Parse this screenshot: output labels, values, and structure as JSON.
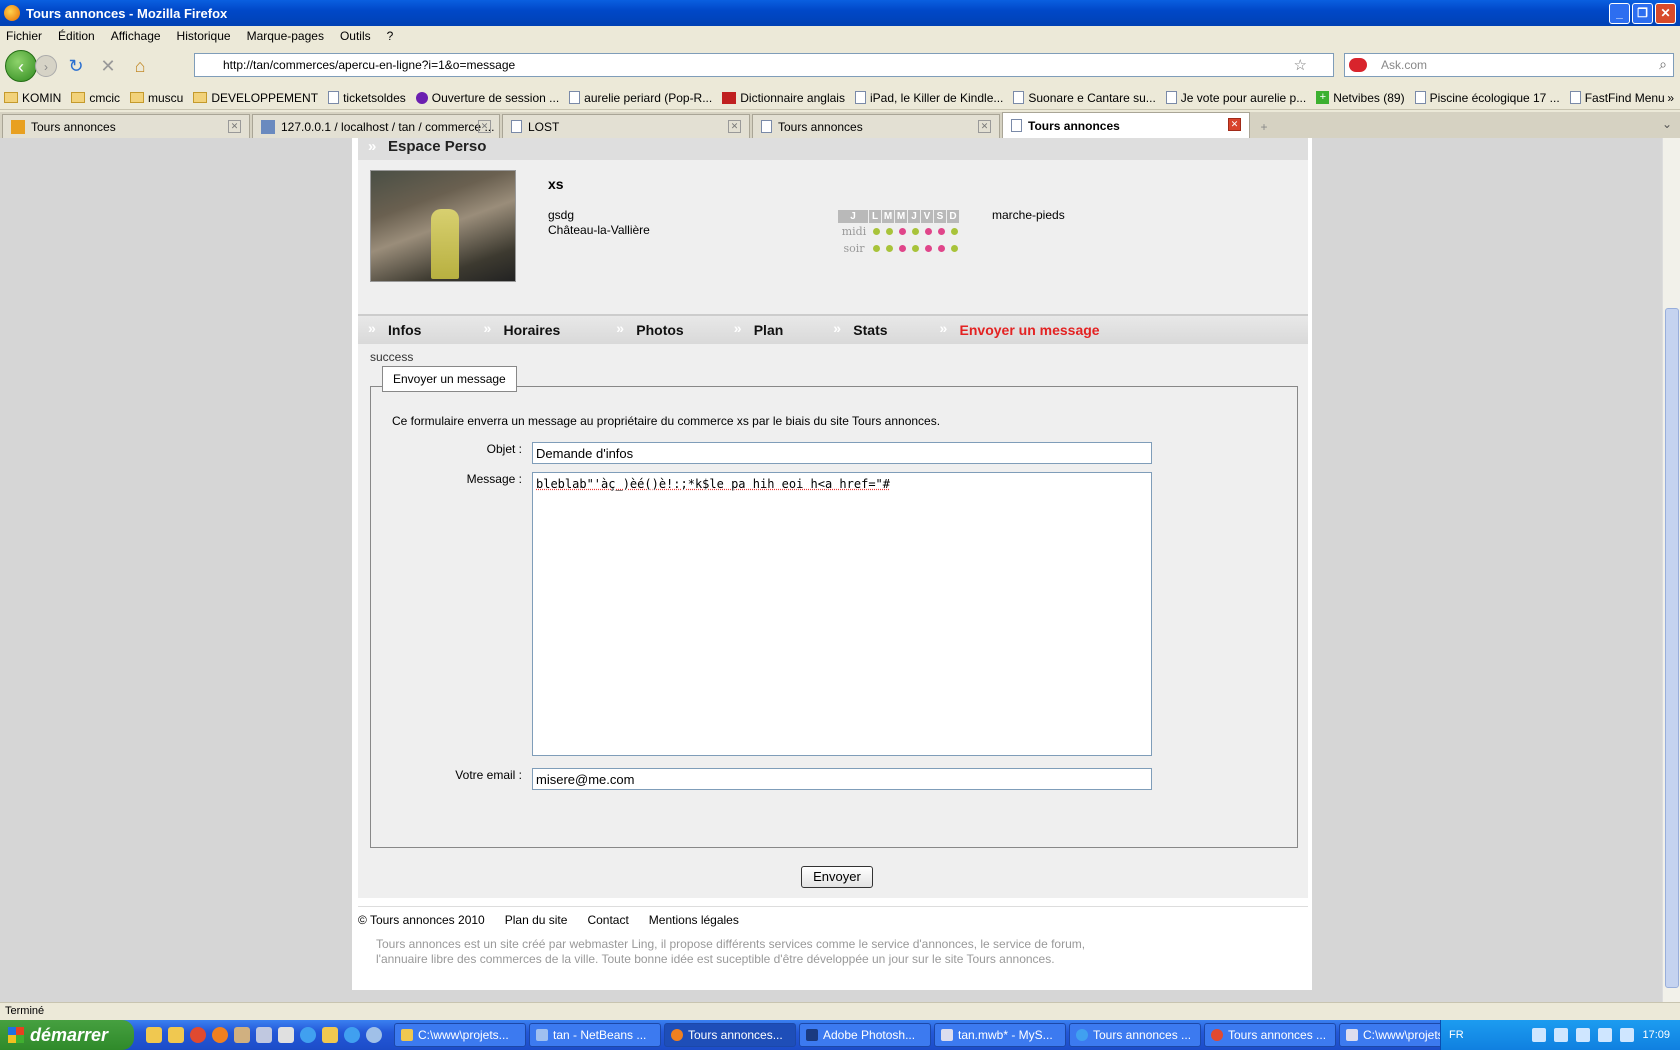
{
  "window": {
    "title": "Tours annonces - Mozilla Firefox"
  },
  "menu": [
    "Fichier",
    "Édition",
    "Affichage",
    "Historique",
    "Marque-pages",
    "Outils",
    "?"
  ],
  "nav": {
    "url": "http://tan/commerces/apercu-en-ligne?i=1&o=message",
    "search_placeholder": "Ask.com"
  },
  "bookmarks": [
    "KOMIN",
    "cmcic",
    "muscu",
    "DEVELOPPEMENT",
    "ticketsoldes",
    "Ouverture de session ...",
    "aurelie periard (Pop-R...",
    "Dictionnaire anglais",
    "iPad, le Killer de Kindle...",
    "Suonare e Cantare su...",
    "Je vote pour aurelie p...",
    "Netvibes (89)",
    "Piscine écologique 17 ...",
    "FastFind Menu"
  ],
  "tabs": [
    "Tours annonces",
    "127.0.0.1 / localhost / tan / commerce ...",
    "LOST",
    "Tours annonces",
    "Tours annonces"
  ],
  "page": {
    "section_title": "Espace Perso",
    "shop": {
      "name": "xs",
      "address1": "gsdg",
      "address2": "Château-la-Vallière",
      "feature": "marche-pieds"
    },
    "schedule": {
      "days": [
        "J",
        "L",
        "M",
        "M",
        "J",
        "V",
        "S",
        "D"
      ],
      "rows": [
        {
          "label": "midi",
          "dots": [
            "#a8c33a",
            "#a8c33a",
            "#a8c33a",
            "#e0458a",
            "#a8c33a",
            "#e0458a",
            "#e0458a",
            "#a8c33a"
          ]
        },
        {
          "label": "soir",
          "dots": [
            "#a8c33a",
            "#a8c33a",
            "#a8c33a",
            "#e0458a",
            "#a8c33a",
            "#e0458a",
            "#e0458a",
            "#a8c33a"
          ]
        }
      ]
    },
    "subnav": [
      "Infos",
      "Horaires",
      "Photos",
      "Plan",
      "Stats",
      "Envoyer un message"
    ],
    "status_msg": "success",
    "form": {
      "legend": "Envoyer un message",
      "intro": "Ce formulaire enverra un message au propriétaire du commerce xs par le biais du site Tours annonces.",
      "subject_label": "Objet :",
      "subject_value": "Demande d'infos",
      "message_label": "Message :",
      "message_value": "bleblab\"'àç_)èé()è!:;*k$le pa hih eoi h<a href=\"#",
      "email_label": "Votre email :",
      "email_value": "misere@me.com",
      "submit_label": "Envoyer"
    },
    "footer": {
      "copyright": "© Tours annonces 2010",
      "links": [
        "Plan du site",
        "Contact",
        "Mentions légales"
      ],
      "text": "Tours annonces est un site créé par webmaster Ling, il propose différents services comme le service d'annonces, le service de forum, l'annuaire libre des commerces de la ville. Toute bonne idée est suceptible d'être développée un jour sur le site Tours annonces."
    }
  },
  "statusbar": "Terminé",
  "taskbar": {
    "start_label": "démarrer",
    "items": [
      "C:\\www\\projets...",
      "tan - NetBeans ...",
      "Tours annonces...",
      "Adobe Photosh...",
      "tan.mwb* - MyS...",
      "Tours annonces ...",
      "Tours annonces ...",
      "C:\\www\\projets..."
    ],
    "lang": "FR",
    "clock": "17:09"
  }
}
